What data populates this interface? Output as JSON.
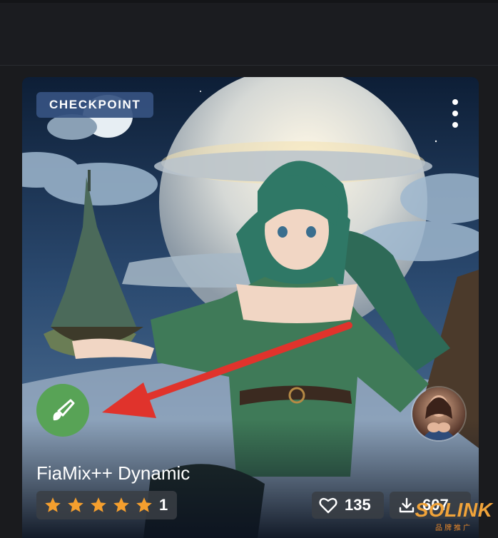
{
  "card": {
    "badge": "CHECKPOINT",
    "title": "FiaMix++ Dynamic",
    "rating": {
      "stars": 5,
      "count": "1"
    },
    "likes": "135",
    "downloads": "607"
  },
  "icons": {
    "menu": "kebab-menu-icon",
    "brush": "brush-icon",
    "star": "star-icon",
    "heart": "heart-icon",
    "download": "download-icon"
  },
  "watermark": {
    "main": "SOLINK",
    "sub": "品牌推广"
  },
  "colors": {
    "badge_bg": "#365281",
    "brush_button": "#58a356",
    "star": "#f59f2e",
    "annotation_arrow": "#e0332c",
    "watermark": "#f0a33a"
  }
}
